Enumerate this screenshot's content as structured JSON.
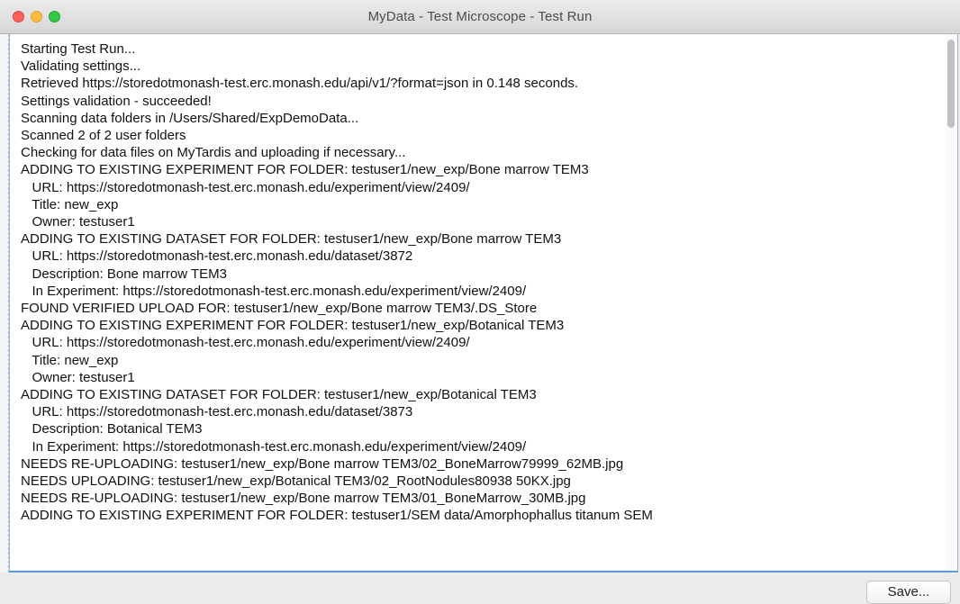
{
  "window": {
    "title": "MyData - Test Microscope - Test Run"
  },
  "log": {
    "lines": [
      "Starting Test Run...",
      "Validating settings...",
      "Retrieved https://storedotmonash-test.erc.monash.edu/api/v1/?format=json in 0.148 seconds.",
      "Settings validation - succeeded!",
      "Scanning data folders in /Users/Shared/ExpDemoData...",
      "Scanned 2 of 2 user folders",
      "Checking for data files on MyTardis and uploading if necessary...",
      "ADDING TO EXISTING EXPERIMENT FOR FOLDER: testuser1/new_exp/Bone marrow TEM3",
      "   URL: https://storedotmonash-test.erc.monash.edu/experiment/view/2409/",
      "   Title: new_exp",
      "   Owner: testuser1",
      "ADDING TO EXISTING DATASET FOR FOLDER: testuser1/new_exp/Bone marrow TEM3",
      "   URL: https://storedotmonash-test.erc.monash.edu/dataset/3872",
      "   Description: Bone marrow TEM3",
      "   In Experiment: https://storedotmonash-test.erc.monash.edu/experiment/view/2409/",
      "FOUND VERIFIED UPLOAD FOR: testuser1/new_exp/Bone marrow TEM3/.DS_Store",
      "ADDING TO EXISTING EXPERIMENT FOR FOLDER: testuser1/new_exp/Botanical TEM3",
      "   URL: https://storedotmonash-test.erc.monash.edu/experiment/view/2409/",
      "   Title: new_exp",
      "   Owner: testuser1",
      "ADDING TO EXISTING DATASET FOR FOLDER: testuser1/new_exp/Botanical TEM3",
      "   URL: https://storedotmonash-test.erc.monash.edu/dataset/3873",
      "   Description: Botanical TEM3",
      "   In Experiment: https://storedotmonash-test.erc.monash.edu/experiment/view/2409/",
      "NEEDS RE-UPLOADING: testuser1/new_exp/Bone marrow TEM3/02_BoneMarrow79999_62MB.jpg",
      "NEEDS UPLOADING: testuser1/new_exp/Botanical TEM3/02_RootNodules80938 50KX.jpg",
      "NEEDS RE-UPLOADING: testuser1/new_exp/Bone marrow TEM3/01_BoneMarrow_30MB.jpg",
      "ADDING TO EXISTING EXPERIMENT FOR FOLDER: testuser1/SEM data/Amorphophallus titanum SEM"
    ]
  },
  "footer": {
    "save_label": "Save..."
  },
  "colors": {
    "close": "#fc605b",
    "minimize": "#fdbc40",
    "maximize": "#34c84a",
    "focus_border": "#5e9bd6"
  }
}
